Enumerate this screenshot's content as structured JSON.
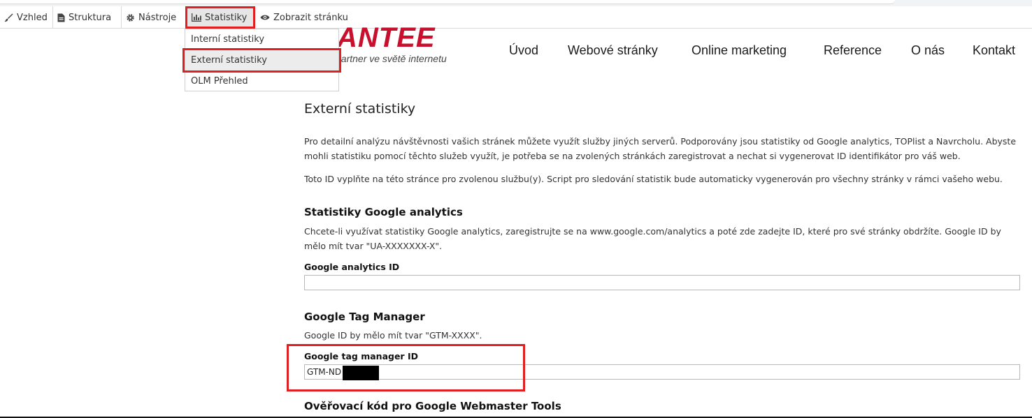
{
  "toolbar": {
    "vzhled": "Vzhled",
    "struktura": "Struktura",
    "nastroje": "Nástroje",
    "statistiky": "Statistiky",
    "zobrazit": "Zobrazit stránku"
  },
  "dropdown": {
    "items": [
      "Interní statistiky",
      "Externí statistiky",
      "OLM Přehled"
    ],
    "active_index": 1
  },
  "header": {
    "logo": "ANTEE",
    "tagline": "partner ve světě internetu",
    "nav": [
      "Úvod",
      "Webové stránky",
      "Online marketing",
      "Reference",
      "O nás",
      "Kontakt"
    ]
  },
  "main": {
    "title": "Externí statistiky",
    "intro_1": "Pro detailní analýzu návštěvnosti vašich stránek můžete využít služby jiných serverů. Podporovány jsou statistiky od Google analytics, TOPlist a Navrcholu. Abyste mohli statistiku pomocí těchto služeb využít, je potřeba se na zvolených stránkách zaregistrovat a nechat si vygenerovat ID identifikátor pro váš web.",
    "intro_2": "Toto ID vyplňte na této stránce pro zvolenou službu(y). Script pro sledování statistik bude automaticky vygenerován pro všechny stránky v rámci vašeho webu.",
    "ga": {
      "heading": "Statistiky Google analytics",
      "description": "Chcete-li využívat statistiky Google analytics, zaregistrujte se na www.google.com/analytics a poté zde zadejte ID, které pro své stránky obdržíte. Google ID by mělo mít tvar \"UA-XXXXXXX-X\".",
      "field_label": "Google analytics ID",
      "value": ""
    },
    "gtm": {
      "heading": "Google Tag Manager",
      "description": "Google ID by mělo mít tvar \"GTM-XXXX\".",
      "field_label": "Google tag manager ID",
      "value": "GTM-ND"
    },
    "gwt": {
      "heading": "Ověřovací kód pro Google Webmaster Tools"
    }
  },
  "colors": {
    "highlight": "#e02020",
    "logo": "#c8102e"
  }
}
